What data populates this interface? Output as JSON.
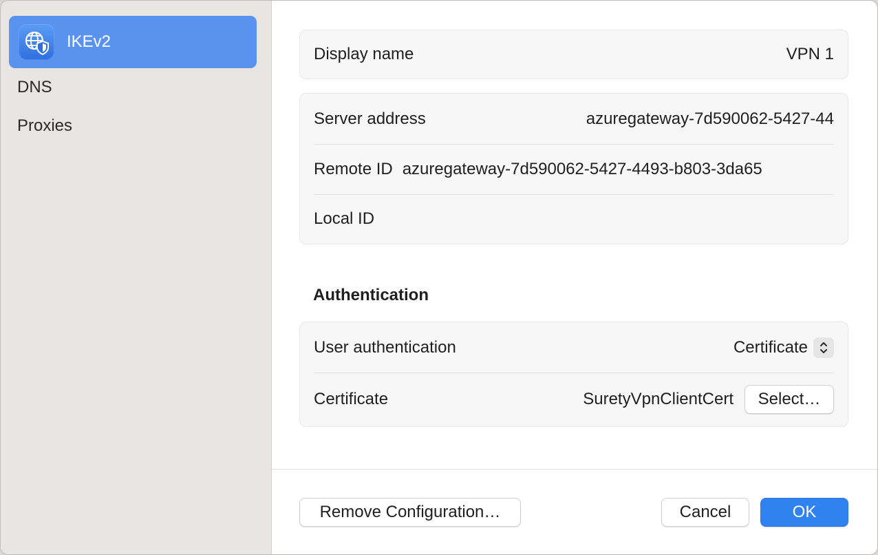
{
  "sidebar": {
    "items": [
      {
        "label": "IKEv2",
        "icon": "globe-shield-icon",
        "selected": true
      },
      {
        "label": "DNS"
      },
      {
        "label": "Proxies"
      }
    ],
    "accent_color": "#5a93ef"
  },
  "general": {
    "display_name_label": "Display name",
    "display_name_value": "VPN 1",
    "server_address_label": "Server address",
    "server_address_value": "azuregateway-7d590062-5427-44",
    "remote_id_label": "Remote ID",
    "remote_id_value": "azuregateway-7d590062-5427-4493-b803-3da65",
    "local_id_label": "Local ID",
    "local_id_value": ""
  },
  "authentication": {
    "section_title": "Authentication",
    "user_auth_label": "User authentication",
    "user_auth_value": "Certificate",
    "certificate_label": "Certificate",
    "certificate_value": "SuretyVpnClientCert",
    "select_button": "Select…"
  },
  "footer": {
    "remove_button": "Remove Configuration…",
    "cancel_button": "Cancel",
    "ok_button": "OK",
    "primary_color": "#2f82f0"
  }
}
